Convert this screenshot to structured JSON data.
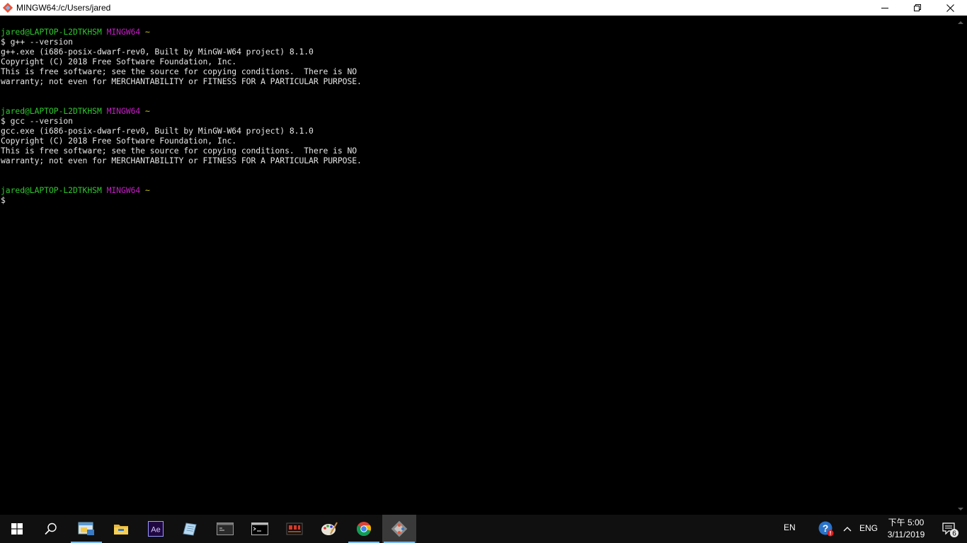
{
  "window": {
    "title": "MINGW64:/c/Users/jared",
    "icon": "git-bash-icon"
  },
  "terminal": {
    "lines": [
      {
        "type": "prompt",
        "user_host": "jared@LAPTOP-L2DTKHSM",
        "env": "MINGW64",
        "path": "~"
      },
      {
        "type": "text",
        "text": "$ g++ --version"
      },
      {
        "type": "text",
        "text": "g++.exe (i686-posix-dwarf-rev0, Built by MinGW-W64 project) 8.1.0"
      },
      {
        "type": "text",
        "text": "Copyright (C) 2018 Free Software Foundation, Inc."
      },
      {
        "type": "text",
        "text": "This is free software; see the source for copying conditions.  There is NO"
      },
      {
        "type": "text",
        "text": "warranty; not even for MERCHANTABILITY or FITNESS FOR A PARTICULAR PURPOSE."
      },
      {
        "type": "blank"
      },
      {
        "type": "blank"
      },
      {
        "type": "prompt",
        "user_host": "jared@LAPTOP-L2DTKHSM",
        "env": "MINGW64",
        "path": "~"
      },
      {
        "type": "text",
        "text": "$ gcc --version"
      },
      {
        "type": "text",
        "text": "gcc.exe (i686-posix-dwarf-rev0, Built by MinGW-W64 project) 8.1.0"
      },
      {
        "type": "text",
        "text": "Copyright (C) 2018 Free Software Foundation, Inc."
      },
      {
        "type": "text",
        "text": "This is free software; see the source for copying conditions.  There is NO"
      },
      {
        "type": "text",
        "text": "warranty; not even for MERCHANTABILITY or FITNESS FOR A PARTICULAR PURPOSE."
      },
      {
        "type": "blank"
      },
      {
        "type": "blank"
      },
      {
        "type": "prompt",
        "user_host": "jared@LAPTOP-L2DTKHSM",
        "env": "MINGW64",
        "path": "~"
      },
      {
        "type": "text",
        "text": "$"
      }
    ],
    "colors": {
      "background": "#000000",
      "text": "#e6e6e6",
      "user_host": "#2ec62e",
      "env": "#c41ec4",
      "path": "#c8c814"
    }
  },
  "taskbar": {
    "apps": [
      {
        "name": "start-icon"
      },
      {
        "name": "search-icon"
      },
      {
        "name": "file-explorer-pinned-icon",
        "active": true
      },
      {
        "name": "folder-icon"
      },
      {
        "name": "after-effects-icon",
        "label": "Ae"
      },
      {
        "name": "notes-app-icon"
      },
      {
        "name": "terminal-window-icon"
      },
      {
        "name": "command-prompt-icon"
      },
      {
        "name": "media-app-icon"
      },
      {
        "name": "paint-palette-icon"
      },
      {
        "name": "chrome-icon",
        "active": true
      },
      {
        "name": "git-bash-icon",
        "active": true,
        "selected": true
      }
    ],
    "tray": {
      "input_lang": "EN",
      "keyboard": "ENG",
      "time": "下午 5:00",
      "date": "3/11/2019",
      "notification_count": "6"
    },
    "accent_color": "#76b9ed"
  }
}
